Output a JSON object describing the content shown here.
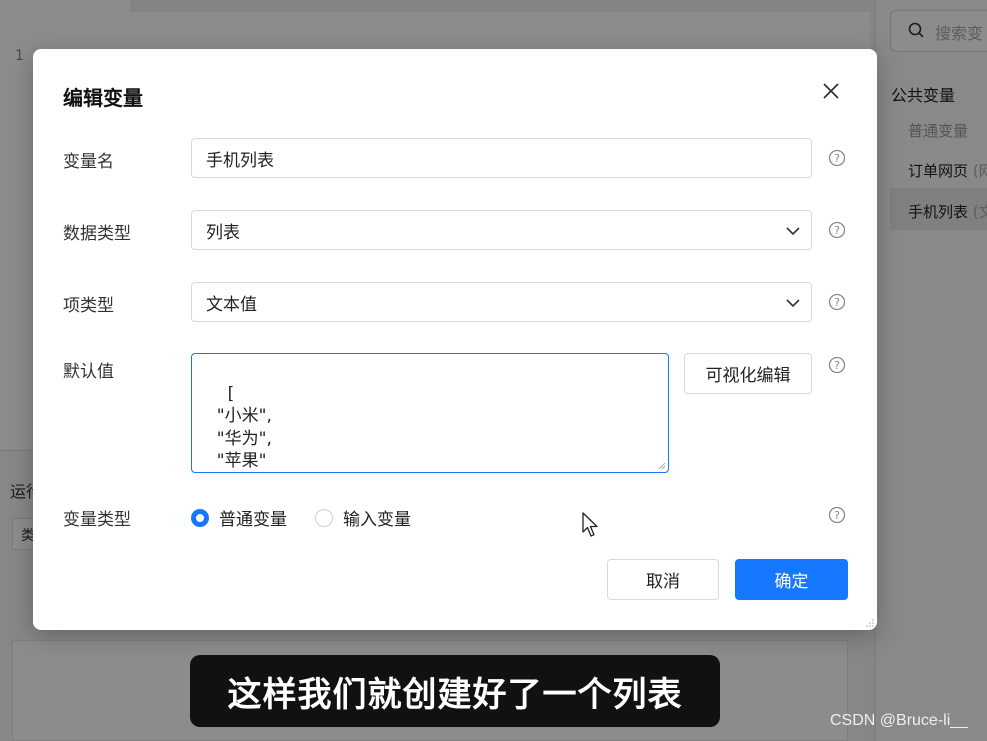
{
  "background": {
    "line_number": "1",
    "run_label": "运行",
    "run_sub": "类",
    "search_placeholder": "搜索变",
    "public_vars_title": "公共变量",
    "public_vars": [
      {
        "name": "普通变量",
        "suffix": ""
      },
      {
        "name": "订单网页",
        "suffix": " (网"
      },
      {
        "name": "手机列表",
        "suffix": " (文"
      }
    ]
  },
  "dialog": {
    "title": "编辑变量",
    "fields": {
      "name_label": "变量名",
      "name_value": "手机列表",
      "data_type_label": "数据类型",
      "data_type_value": "列表",
      "item_type_label": "项类型",
      "item_type_value": "文本值",
      "default_label": "默认值",
      "default_value": "[\n  \"小米\",\n  \"华为\",\n  \"苹果\"\n]",
      "visual_edit_label": "可视化编辑",
      "var_type_label": "变量类型",
      "var_type_options": [
        "普通变量",
        "输入变量"
      ],
      "var_type_selected": "普通变量"
    },
    "buttons": {
      "cancel": "取消",
      "ok": "确定"
    }
  },
  "subtitle": "这样我们就创建好了一个列表",
  "watermark": "CSDN @Bruce-li__",
  "colors": {
    "primary": "#1677ff",
    "overlay": "rgba(0,0,0,0.45)"
  }
}
